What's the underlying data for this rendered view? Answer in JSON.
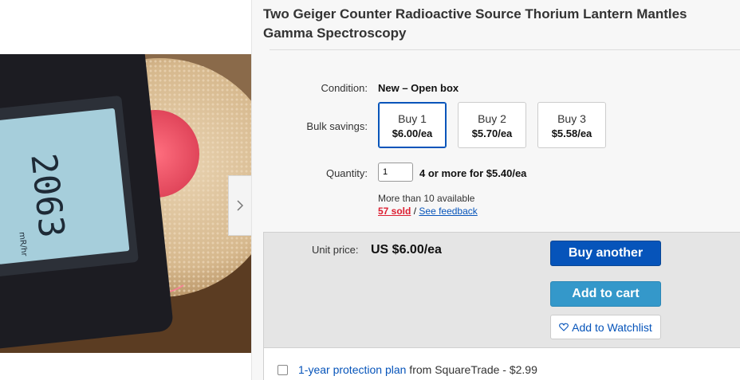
{
  "listing": {
    "title": "Two Geiger Counter Radioactive Source Thorium Lantern Mantles Gamma Spectroscopy"
  },
  "gallery": {
    "next_icon": "chevron-right-icon",
    "photo_readout": "2063",
    "photo_unit": "mR/hr"
  },
  "condition": {
    "label": "Condition:",
    "value": "New – Open box"
  },
  "bulk": {
    "label": "Bulk savings:",
    "options": [
      {
        "label": "Buy 1",
        "price": "$6.00/ea",
        "selected": true
      },
      {
        "label": "Buy 2",
        "price": "$5.70/ea",
        "selected": false
      },
      {
        "label": "Buy 3",
        "price": "$5.58/ea",
        "selected": false
      }
    ]
  },
  "quantity": {
    "label": "Quantity:",
    "value": "1",
    "promo": "4 or more for $5.40/ea",
    "availability": "More than 10 available",
    "sold": "57 sold",
    "separator": "/",
    "feedback": "See feedback"
  },
  "purchase": {
    "unit_label": "Unit price:",
    "unit_price": "US $6.00/ea",
    "buy_label": "Buy another",
    "cart_label": "Add to cart",
    "watch_label": "Add to Watchlist",
    "watch_icon": "heart-outline-icon"
  },
  "protection": {
    "link": "1-year protection plan",
    "text": " from SquareTrade - $2.99",
    "checked": false
  },
  "colors": {
    "primary_blue": "#0654ba",
    "cart_blue": "#3498ca",
    "sold_red": "#dd1e31"
  }
}
